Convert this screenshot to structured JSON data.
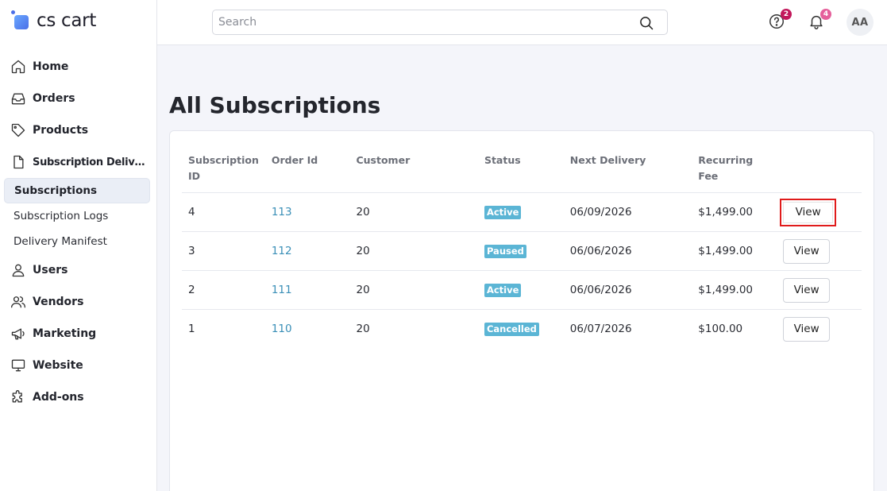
{
  "brand": {
    "name": "cs cart",
    "accent": "#4b6fe8"
  },
  "sidebar": {
    "items": [
      {
        "label": "Home",
        "icon": "home-icon"
      },
      {
        "label": "Orders",
        "icon": "inbox-icon"
      },
      {
        "label": "Products",
        "icon": "tag-icon"
      },
      {
        "label": "Subscription Delivery ...",
        "icon": "document-icon"
      },
      {
        "label": "Users",
        "icon": "user-icon"
      },
      {
        "label": "Vendors",
        "icon": "users-icon"
      },
      {
        "label": "Marketing",
        "icon": "megaphone-icon"
      },
      {
        "label": "Website",
        "icon": "monitor-icon"
      },
      {
        "label": "Add-ons",
        "icon": "puzzle-icon"
      }
    ],
    "subitems": [
      {
        "label": "Subscriptions",
        "active": true
      },
      {
        "label": "Subscription Logs",
        "active": false
      },
      {
        "label": "Delivery Manifest",
        "active": false
      }
    ]
  },
  "topbar": {
    "search_placeholder": "Search",
    "help_badge": "2",
    "help_badge_color": "#c2185b",
    "notifications_badge": "4",
    "notifications_badge_color": "#e5609b",
    "avatar_initials": "AA"
  },
  "main": {
    "title": "All Subscriptions",
    "table": {
      "headers": {
        "id_line1": "Subscription",
        "id_line2": "ID",
        "order": "Order Id",
        "customer": "Customer",
        "status": "Status",
        "next_delivery": "Next Delivery",
        "fee": "Recurring Fee"
      },
      "rows": [
        {
          "id": "4",
          "order": "113",
          "customer": "20",
          "status": "Active",
          "next": "06/09/2026",
          "fee": "$1,499.00",
          "action": "View"
        },
        {
          "id": "3",
          "order": "112",
          "customer": "20",
          "status": "Paused",
          "next": "06/06/2026",
          "fee": "$1,499.00",
          "action": "View"
        },
        {
          "id": "2",
          "order": "111",
          "customer": "20",
          "status": "Active",
          "next": "06/06/2026",
          "fee": "$1,499.00",
          "action": "View"
        },
        {
          "id": "1",
          "order": "110",
          "customer": "20",
          "status": "Cancelled",
          "next": "06/07/2026",
          "fee": "$100.00",
          "action": "View"
        }
      ]
    }
  }
}
